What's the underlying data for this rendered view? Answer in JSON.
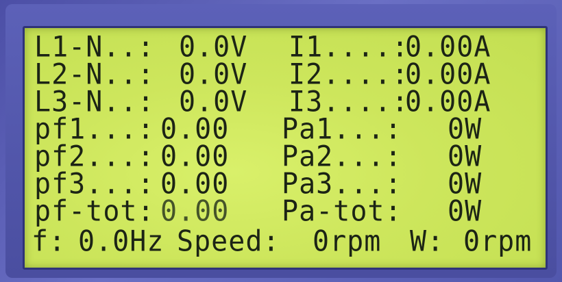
{
  "display": {
    "rows": [
      {
        "c1": "L1-N..:",
        "c2": "0.0V",
        "c3": "I1....:",
        "c4": "0.00A"
      },
      {
        "c1": "L2-N..:",
        "c2": "0.0V",
        "c3": "I2....:",
        "c4": "0.00A"
      },
      {
        "c1": "L3-N..:",
        "c2": "0.0V",
        "c3": "I3....:",
        "c4": "0.00A"
      },
      {
        "c1": "pf1...:",
        "c2": "0.00",
        "c3": "Pa1...:",
        "c4": "0W"
      },
      {
        "c1": "pf2...:",
        "c2": "0.00",
        "c3": "Pa2...:",
        "c4": "0W"
      },
      {
        "c1": "pf3...:",
        "c2": "0.00",
        "c3": "Pa3...:",
        "c4": "0W"
      },
      {
        "c1": "pf-tot:",
        "c2": "0.00",
        "c3": "Pa-tot:",
        "c4": "0W"
      }
    ],
    "footer": {
      "freq_label": "f:",
      "freq_value": "0.0Hz",
      "speed_label": "Speed:",
      "speed_value": "0rpm",
      "w_label": "W:",
      "w_value": "0rpm"
    }
  },
  "colors": {
    "lcd_background": "#cde65c",
    "lcd_text": "#1c2415",
    "bezel": "#5a5fb0"
  }
}
